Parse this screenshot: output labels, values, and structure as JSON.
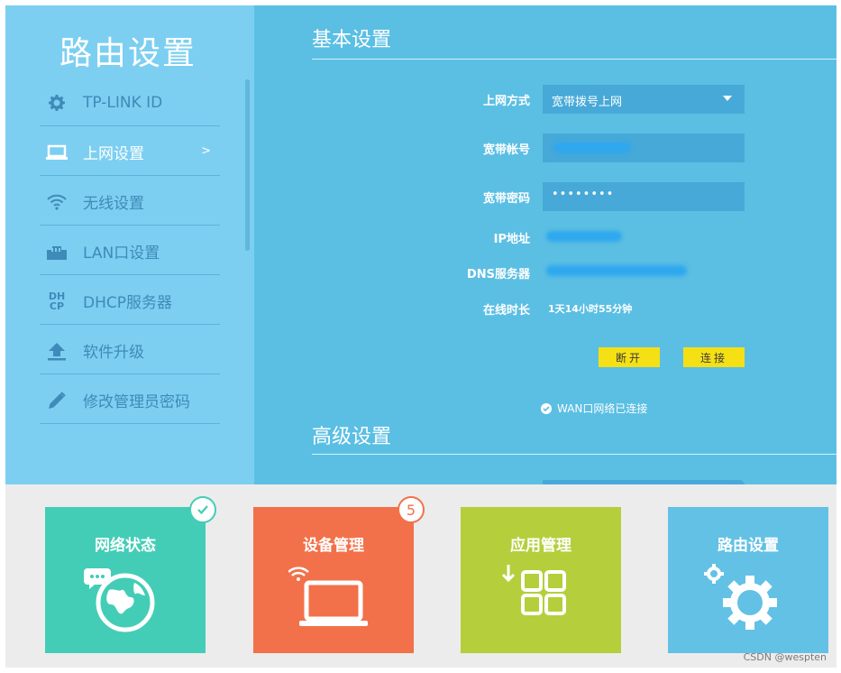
{
  "sidebar": {
    "title": "路由设置",
    "items": [
      {
        "label": "TP-LINK ID",
        "icon": "gear-icon"
      },
      {
        "label": "上网设置",
        "icon": "laptop-icon",
        "active": true,
        "arrow": ">"
      },
      {
        "label": "无线设置",
        "icon": "wifi-icon"
      },
      {
        "label": "LAN口设置",
        "icon": "lan-port-icon"
      },
      {
        "label": "DHCP服务器",
        "icon": "dhcp-icon",
        "icon_text": "DH CP"
      },
      {
        "label": "软件升级",
        "icon": "upload-icon"
      },
      {
        "label": "修改管理员密码",
        "icon": "pencil-icon"
      }
    ]
  },
  "main": {
    "basic_title": "基本设置",
    "advanced_title": "高级设置",
    "form": {
      "conn_type_label": "上网方式",
      "conn_type_value": "宽带拨号上网",
      "account_label": "宽带帐号",
      "password_label": "宽带密码",
      "password_value": "••••••••",
      "ip_label": "IP地址",
      "dns_label": "DNS服务器",
      "uptime_label": "在线时长",
      "uptime_value": "1天14小时55分钟"
    },
    "disconnect_label": "断开",
    "connect_label": "连接",
    "status_text": "WAN口网络已连接"
  },
  "tiles": [
    {
      "label": "网络状态",
      "color": "#43cdb6",
      "icon": "globe-chat-icon",
      "badge_icon": "check-icon"
    },
    {
      "label": "设备管理",
      "color": "#f2714a",
      "icon": "laptop-wifi-icon",
      "badge": "5"
    },
    {
      "label": "应用管理",
      "color": "#b5cf3c",
      "icon": "apps-grid-icon"
    },
    {
      "label": "路由设置",
      "color": "#62c1e5",
      "icon": "gears-icon"
    }
  ],
  "colors": {
    "sidebar_bg": "#7ccff0",
    "main_bg": "#5bbee3",
    "field_bg": "#46a9d8",
    "button_yellow": "#f5e016",
    "bottom_bg": "#ececec"
  },
  "watermark": "CSDN @wespten"
}
